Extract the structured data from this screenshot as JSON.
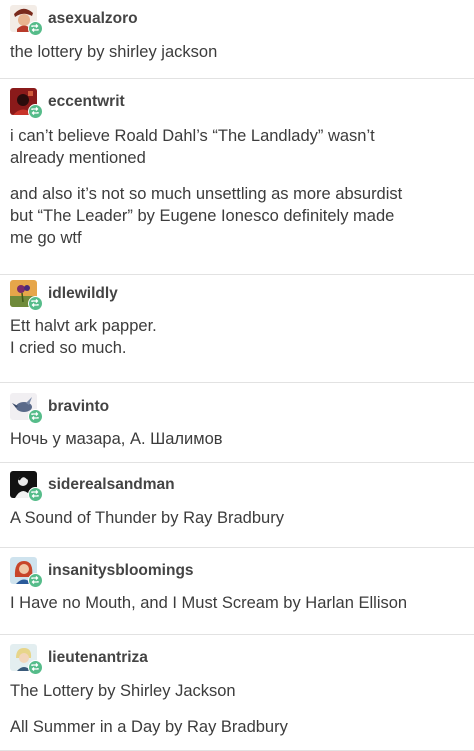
{
  "posts": [
    {
      "username": "asexualzoro",
      "avatar_icon": "avatar-pirate-icon",
      "paragraphs": [
        "the lottery by shirley jackson"
      ]
    },
    {
      "username": "eccentwrit",
      "avatar_icon": "avatar-red-portrait-icon",
      "paragraphs": [
        "i can’t believe Roald Dahl’s “The Landlady” wasn’t\nalready mentioned",
        "and also it’s not so much unsettling as more absurdist\nbut “The Leader” by Eugene Ionesco definitely made\nme go wtf"
      ]
    },
    {
      "username": "idlewildly",
      "avatar_icon": "avatar-flower-icon",
      "paragraphs": [
        "Ett halvt ark papper.\nI cried so much."
      ]
    },
    {
      "username": "bravinto",
      "avatar_icon": "avatar-bird-icon",
      "paragraphs": [
        "Ночь у мазара, А. Шалимов"
      ]
    },
    {
      "username": "siderealsandman",
      "avatar_icon": "avatar-dark-figure-icon",
      "paragraphs": [
        "A Sound of Thunder by Ray Bradbury"
      ]
    },
    {
      "username": "insanitysbloomings",
      "avatar_icon": "avatar-redhead-icon",
      "paragraphs": [
        "I Have no Mouth, and I Must Scream by Harlan Ellison"
      ]
    },
    {
      "username": "lieutenantriza",
      "avatar_icon": "avatar-cartoon-icon",
      "paragraphs": [
        "The Lottery by Shirley Jackson",
        "All Summer in a Day by Ray Bradbury"
      ]
    }
  ],
  "reblog_icon": "reblog-icon",
  "colors": {
    "reblog_badge": "#56bc8a",
    "text": "#3c3c3c",
    "divider": "#e2e2e2"
  }
}
